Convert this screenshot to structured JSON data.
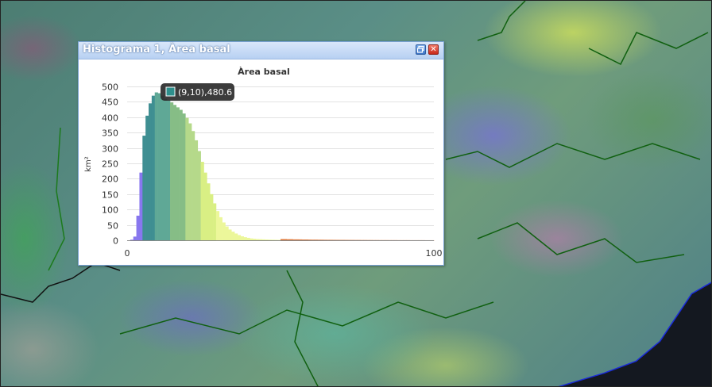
{
  "window": {
    "title": "Histograma 1, Àrea basal",
    "restore_icon": "restore-window-icon",
    "close_icon": "close-icon",
    "close_glyph": "✕"
  },
  "tooltip": {
    "swatch_color": "#2e8f8c",
    "text": "(9,10),480.6"
  },
  "chart_data": {
    "type": "bar",
    "title": "Àrea basal",
    "ylabel": "km²",
    "xlabel": "",
    "xlim": [
      0,
      100
    ],
    "ylim": [
      0,
      500
    ],
    "yticks": [
      0,
      50,
      100,
      150,
      200,
      250,
      300,
      350,
      400,
      450,
      500
    ],
    "xtick_labels": [
      "0",
      "100"
    ],
    "grid": true,
    "bin_width": 1,
    "x": [
      0,
      1,
      2,
      3,
      4,
      5,
      6,
      7,
      8,
      9,
      10,
      11,
      12,
      13,
      14,
      15,
      16,
      17,
      18,
      19,
      20,
      21,
      22,
      23,
      24,
      25,
      26,
      27,
      28,
      29,
      30,
      31,
      32,
      33,
      34,
      35,
      36,
      37,
      38,
      39,
      40,
      41,
      42,
      43,
      44,
      45,
      46,
      47,
      48,
      49,
      50,
      51,
      52,
      53,
      54,
      55,
      56,
      57,
      58,
      59,
      60,
      61,
      62,
      63,
      64,
      65,
      66,
      67,
      68,
      69,
      70,
      71,
      72,
      73,
      74,
      75,
      76,
      77,
      78,
      79,
      80,
      81,
      82,
      83,
      84,
      85,
      86,
      87,
      88,
      89,
      90,
      91,
      92,
      93,
      94,
      95,
      96,
      97,
      98,
      99
    ],
    "values": [
      0,
      2,
      12,
      80,
      220,
      340,
      405,
      445,
      470,
      480.6,
      478,
      470,
      460,
      455,
      448,
      440,
      432,
      424,
      412,
      398,
      380,
      355,
      325,
      290,
      255,
      220,
      185,
      150,
      120,
      95,
      75,
      58,
      45,
      35,
      28,
      22,
      17,
      13,
      10,
      8,
      6,
      5,
      4,
      3.5,
      3,
      2.5,
      2,
      1.8,
      1.5,
      1.3,
      4,
      4,
      3.5,
      3.5,
      3,
      3,
      2.8,
      2.5,
      2.5,
      2.2,
      2,
      2,
      1.8,
      1.8,
      1.6,
      1.5,
      1.5,
      1.4,
      1.3,
      1.2,
      1.2,
      1.1,
      1,
      1,
      0.9,
      0.9,
      0.8,
      0.8,
      0.7,
      0.7,
      0.6,
      0.6,
      0.5,
      0.5,
      0.5,
      0.4,
      0.4,
      0.4,
      0.3,
      0.3,
      0.3,
      0.3,
      0.2,
      0.2,
      0.2,
      0.2,
      0.2,
      0.1,
      0.1,
      0.1
    ],
    "color_classes": [
      {
        "from": 0,
        "to": 5,
        "color": "#8877ee"
      },
      {
        "from": 5,
        "to": 9,
        "color": "#3f8f92"
      },
      {
        "from": 9,
        "to": 14,
        "color": "#5fa896"
      },
      {
        "from": 14,
        "to": 19,
        "color": "#86bd86"
      },
      {
        "from": 19,
        "to": 24,
        "color": "#b5d98a"
      },
      {
        "from": 24,
        "to": 29,
        "color": "#d9ef84"
      },
      {
        "from": 29,
        "to": 50,
        "color": "#ecf79a"
      },
      {
        "from": 50,
        "to": 100,
        "color": "#e07a3c"
      }
    ]
  }
}
